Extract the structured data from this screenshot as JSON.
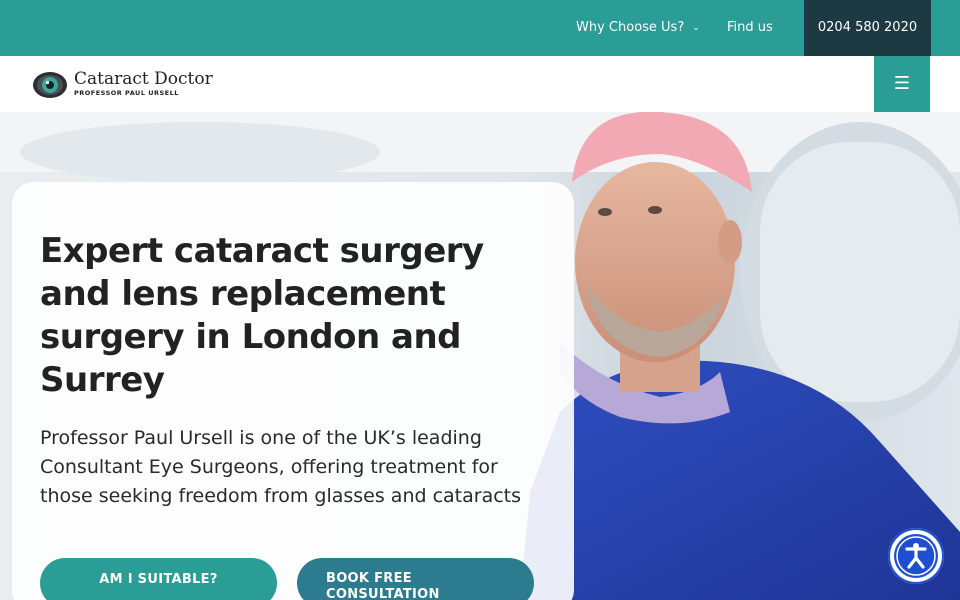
{
  "topbar": {
    "why_label": "Why Choose Us?",
    "why_chevron": "⌄",
    "find_label": "Find us",
    "phone": "0204 580 2020"
  },
  "header": {
    "logo_title": "Cataract Doctor",
    "logo_subtitle": "PROFESSOR PAUL URSELL",
    "menu_icon": "☰"
  },
  "hero": {
    "headline": "Expert cataract surgery and lens replacement surgery in London and Surrey",
    "lede": "Professor Paul Ursell is one of the UK’s leading Consultant Eye Surgeons, offering treatment for those seeking freedom from glasses and cataracts",
    "cta_primary": "AM I SUITABLE?",
    "cta_secondary_line1": "BOOK FREE",
    "cta_secondary_line2": "CONSULTATION"
  },
  "colors": {
    "teal": "#2a9d96",
    "navy": "#1d3a43",
    "accessibility_blue": "#1f4fd1"
  },
  "icons": {
    "menu": "hamburger-menu-icon",
    "chevron": "chevron-down-icon",
    "accessibility": "accessibility-icon",
    "logo": "eye-logo-icon"
  }
}
